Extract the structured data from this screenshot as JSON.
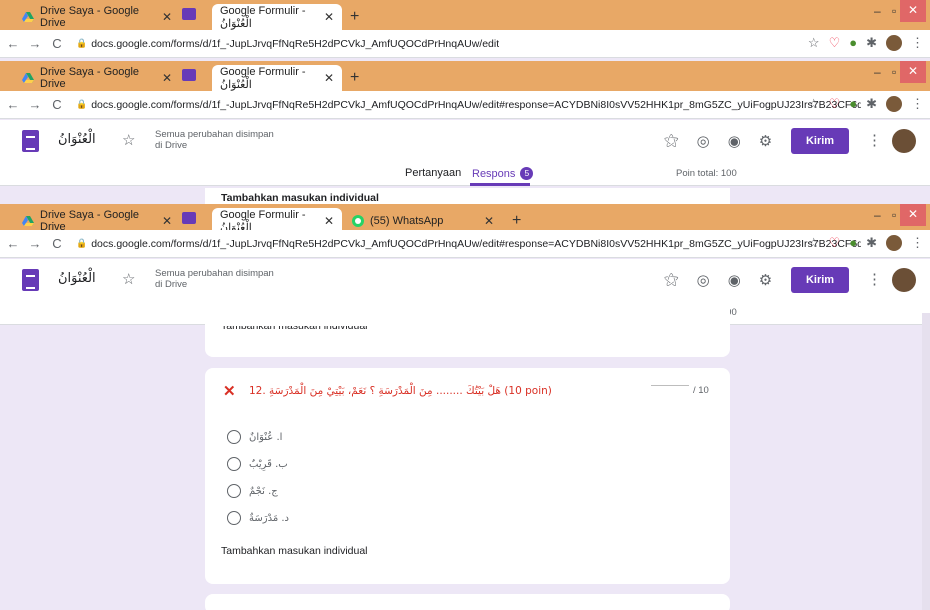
{
  "browser_windows": [
    {
      "tabs": [
        {
          "title": "Drive Saya - Google Drive"
        },
        {
          "title": "Google Formulir - الْعُنْوَانُ"
        }
      ],
      "url": "docs.google.com/forms/d/1f_-JupLJrvqFfNqRe5H2dPCVkJ_AmfUQOCdPrHnqAUw/edit"
    },
    {
      "tabs": [
        {
          "title": "Drive Saya - Google Drive"
        },
        {
          "title": "Google Formulir - الْعُنْوَانُ"
        }
      ],
      "url": "docs.google.com/forms/d/1f_-JupLJrvqFfNqRe5H2dPCVkJ_AmfUQOCdPrHnqAUw/edit#response=ACYDBNi8I0sVV52HHK1pr_8mG5ZC_yUiFogpUJ23Irs7B23CF6qr..."
    },
    {
      "tabs": [
        {
          "title": "Drive Saya - Google Drive"
        },
        {
          "title": "Google Formulir - الْعُنْوَانُ"
        },
        {
          "title": "(55) WhatsApp"
        }
      ],
      "url": "docs.google.com/forms/d/1f_-JupLJrvqFfNqRe5H2dPCVkJ_AmfUQOCdPrHnqAUw/edit#response=ACYDBNi8I0sVV52HHK1pr_8mG5ZC_yUiFogpUJ23Irs7B23CF6qr..."
    }
  ],
  "forms_header": {
    "title": "الْعُنْوَانُ",
    "saved_line1": "Semua perubahan disimpan",
    "saved_line2": "di Drive",
    "send_label": "Kirim"
  },
  "forms_tabs": {
    "questions": "Pertanyaan",
    "responses": "Respons",
    "responses_count": "5",
    "points_total": "Poin total: 100"
  },
  "individual_entry_label": "Tambahkan masukan individual",
  "question": {
    "text": "12. هَلْ بَيْتُكَ ........ مِنَ الْمَدْرَسَةِ ؟ نَعَمْ، بَيْتِيْ مِنَ الْمَدْرَسَةِ (10 poin)",
    "max_score": "/ 10",
    "options": [
      "ا. عُنْوَانٌ",
      "ب. قَرِيْبٌ",
      "ج. نَجْمٌ",
      "د. مَدْرَسَةٌ"
    ]
  },
  "colors": {
    "accent": "#673ab7",
    "wrong": "#d93025",
    "tabbar": "#e8a866",
    "background": "#ede7f6"
  }
}
